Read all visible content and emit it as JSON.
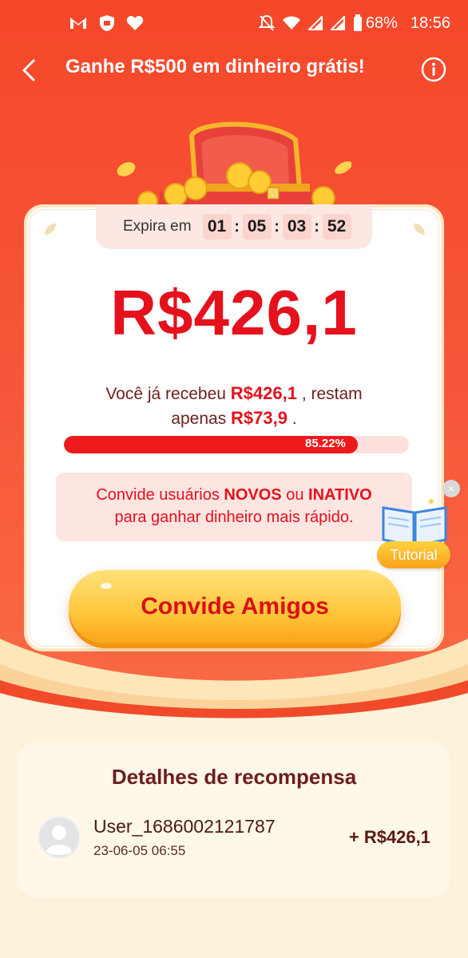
{
  "status_bar": {
    "battery": "68%",
    "time": "18:56",
    "left_icons": [
      "gmail-icon",
      "shield-icon",
      "heart-icon"
    ],
    "right_icons": [
      "mute-icon",
      "wifi-icon",
      "signal-icon",
      "signal-icon",
      "battery-icon"
    ]
  },
  "header": {
    "title": "Ganhe R$500 em dinheiro grátis!"
  },
  "timer": {
    "label": "Expira em",
    "days": "01",
    "hours": "05",
    "minutes": "03",
    "seconds": "52"
  },
  "reward": {
    "amount": "R$426,1",
    "received_prefix": "Você já recebeu",
    "received_amount": "R$426,1",
    "received_mid": ", restam",
    "remaining_prefix": "apenas",
    "remaining_amount": "R$73,9",
    "remaining_suffix": ".",
    "progress_percent": 85.22,
    "progress_label": "85.22%"
  },
  "invite_note": {
    "part1": "Convide usuários",
    "bold1": "NOVOS",
    "part2": "ou",
    "bold2": "INATIVO",
    "line2": "para ganhar dinheiro mais rápido."
  },
  "invite_button": {
    "label": "Convide Amigos"
  },
  "tutorial": {
    "label": "Tutorial",
    "close": "×"
  },
  "details": {
    "title": "Detalhes de recompensa",
    "entries": [
      {
        "user": "User_1686002121787",
        "time": "23-06-05 06:55",
        "amount": "+ R$426,1"
      }
    ]
  },
  "colors": {
    "hero_red": "#f5472a",
    "accent_red": "#e5111c",
    "button_yellow": "#ffc43a",
    "cream": "#fdf3dc"
  }
}
